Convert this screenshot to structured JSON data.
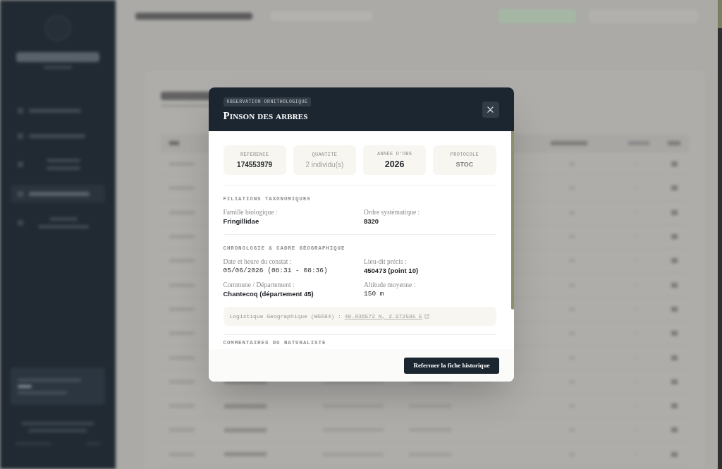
{
  "modal": {
    "badge": "OBSERVATION ORNITHOLOGIQUE",
    "title": "Pinson des arbres",
    "stats": [
      {
        "label": "RÉFÉRENCE",
        "value": "174553979",
        "kind": "strong"
      },
      {
        "label": "QUANTITÉ",
        "value": "2 individu(s)",
        "kind": "faded"
      },
      {
        "label": "ANNÉE D'OBS",
        "value": "2026",
        "kind": "large"
      },
      {
        "label": "PROTOCOLE",
        "value": "STOC",
        "kind": "muted"
      }
    ],
    "sections": [
      {
        "title": "FILIATIONS TAXONOMIQUES",
        "fields": [
          {
            "label": "Famille biologique :",
            "value": "Fringillidae",
            "kind": "text"
          },
          {
            "label": "Ordre systématique :",
            "value": "8320",
            "kind": "text"
          }
        ]
      },
      {
        "title": "CHRONOLOGIE & CADRE GÉOGRAPHIQUE",
        "fields": [
          {
            "label": "Date et heure du constat :",
            "value": "05/06/2026 (08:31 - 08:36)",
            "kind": "mono"
          },
          {
            "label": "Lieu-dit précis :",
            "value": "450473 (point 10)",
            "kind": "text"
          },
          {
            "label": "Commune / Département :",
            "value": "Chantecoq (département 45)",
            "kind": "text"
          },
          {
            "label": "Altitude moyenne :",
            "value": "150 m",
            "kind": "mono"
          }
        ],
        "coordinates": {
          "label": "Logistique Géographique (WGS84) :",
          "link": "48.036572 N, 2.972595 E"
        }
      },
      {
        "title": "COMMENTAIRES DU NATURALISTE"
      }
    ],
    "close_button": "Refermer la fiche historique"
  }
}
